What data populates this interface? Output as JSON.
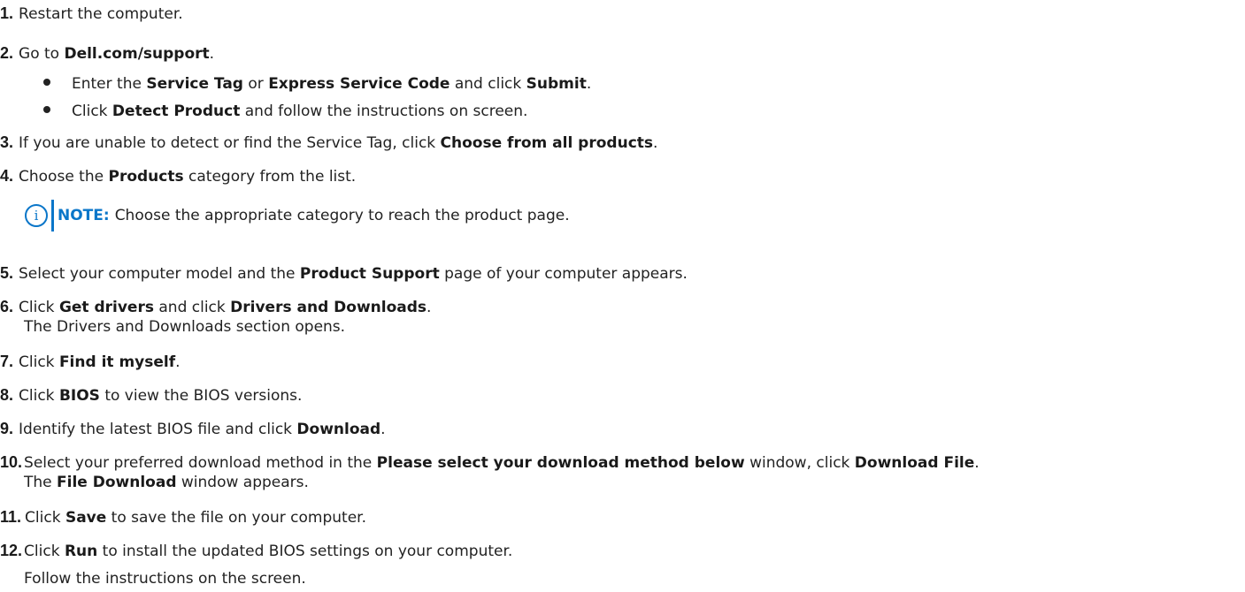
{
  "steps": [
    {
      "num": "1.",
      "parts": [
        "Restart the computer."
      ]
    },
    {
      "num": "2.",
      "parts": [
        "Go to ",
        "Dell.com/support",
        "."
      ]
    },
    {
      "num": "3.",
      "parts": [
        "If you are unable to detect or find the Service Tag, click ",
        "Choose from all products",
        "."
      ]
    },
    {
      "num": "4.",
      "parts": [
        "Choose the ",
        "Products",
        " category from the list."
      ]
    },
    {
      "num": "5.",
      "parts": [
        "Select your computer model and the ",
        "Product Support",
        " page of your computer appears."
      ]
    },
    {
      "num": "6.",
      "parts": [
        "Click ",
        "Get drivers",
        " and click ",
        "Drivers and Downloads",
        "."
      ],
      "cont": "The Drivers and Downloads section opens."
    },
    {
      "num": "7.",
      "parts": [
        "Click ",
        "Find it myself",
        "."
      ]
    },
    {
      "num": "8.",
      "parts": [
        "Click ",
        "BIOS",
        " to view the BIOS versions."
      ]
    },
    {
      "num": "9.",
      "parts": [
        "Identify the latest BIOS file and click ",
        "Download",
        "."
      ]
    },
    {
      "num": "10.",
      "parts": [
        "Select your preferred download method in the ",
        "Please select your download method below",
        " window, click ",
        "Download File",
        "."
      ],
      "cont_parts": [
        "The ",
        "File Download",
        " window appears."
      ]
    },
    {
      "num": "11.",
      "parts": [
        "Click ",
        "Save",
        " to save the file on your computer."
      ]
    },
    {
      "num": "12.",
      "parts": [
        "Click ",
        "Run",
        " to install the updated BIOS settings on your computer."
      ],
      "cont": "Follow the instructions on the screen."
    }
  ],
  "substeps": [
    {
      "parts": [
        "Enter the ",
        "Service Tag",
        " or ",
        "Express Service Code",
        " and click ",
        "Submit",
        "."
      ]
    },
    {
      "parts": [
        "Click ",
        "Detect Product",
        " and follow the instructions on screen."
      ]
    }
  ],
  "note": {
    "icon": "info-icon",
    "label": "NOTE:",
    "text": "Choose the appropriate category to reach the product page."
  },
  "colors": {
    "note_accent": "#0a76c9",
    "text": "#222222"
  }
}
